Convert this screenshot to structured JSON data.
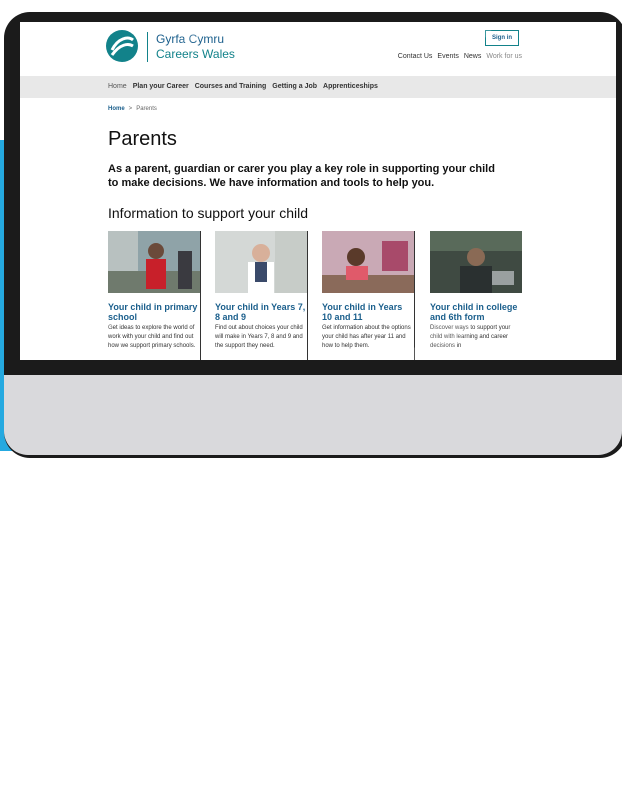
{
  "logo": {
    "line1": "Gyrfa Cymru",
    "line2": "Careers Wales"
  },
  "header": {
    "sign_in": "Sign in",
    "links": [
      "Contact Us",
      "Events",
      "News",
      "Work for us"
    ]
  },
  "nav": {
    "items": [
      "Home",
      "Plan your Career",
      "Courses and Training",
      "Getting a Job",
      "Apprenticeships"
    ]
  },
  "breadcrumb": {
    "home": "Home",
    "separator": ">",
    "current": "Parents"
  },
  "page": {
    "title": "Parents",
    "intro": "As a parent, guardian or carer you play a key role in supporting your child to make decisions. We have information and tools to help you.",
    "section_title": "Information to support your child"
  },
  "cards": [
    {
      "title": "Your child in primary school",
      "body": "Get ideas to explore the world of work with your child and find out how we support primary schools."
    },
    {
      "title": "Your child in Years 7, 8 and 9",
      "body": "Find out about choices your child will make in Years 7, 8 and 9 and the support they need."
    },
    {
      "title": "Your child in Years 10 and 11",
      "body": "Get information about the options your child has after year 11 and how to help them."
    },
    {
      "title": "Your child in college and 6th form",
      "body": "Discover ways to support your child with learning and career decisions in"
    }
  ],
  "colors": {
    "brand_teal": "#12828a",
    "brand_blue": "#1b5f8c",
    "accent_cyan": "#25a9e0",
    "monitor_frame": "#1b1b1b"
  }
}
